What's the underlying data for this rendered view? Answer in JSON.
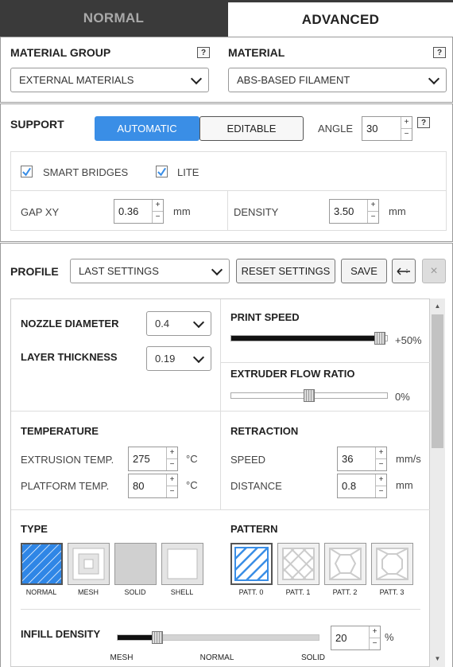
{
  "tabs": {
    "normal": "NORMAL",
    "advanced": "ADVANCED"
  },
  "material": {
    "group_label": "MATERIAL GROUP",
    "group_value": "EXTERNAL MATERIALS",
    "material_label": "MATERIAL",
    "material_value": "ABS-BASED FILAMENT",
    "help": "?"
  },
  "support": {
    "label": "SUPPORT",
    "automatic": "AUTOMATIC",
    "editable": "EDITABLE",
    "angle_label": "ANGLE",
    "angle_value": "30",
    "smart_bridges": "SMART BRIDGES",
    "smart_bridges_checked": true,
    "lite": "LITE",
    "lite_checked": true,
    "gap_xy_label": "GAP XY",
    "gap_xy_value": "0.36",
    "gap_unit": "mm",
    "density_label": "DENSITY",
    "density_value": "3.50",
    "density_unit": "mm",
    "accent": "#3a8ee6"
  },
  "profile": {
    "label": "PROFILE",
    "value": "LAST SETTINGS",
    "reset": "RESET SETTINGS",
    "save": "SAVE",
    "close": "×"
  },
  "settings": {
    "nozzle_label": "NOZZLE DIAMETER",
    "nozzle_value": "0.4",
    "layer_label": "LAYER THICKNESS",
    "layer_value": "0.19",
    "print_speed_label": "PRINT SPEED",
    "print_speed_value": "+50%",
    "print_speed_fraction": 0.99,
    "flow_label": "EXTRUDER FLOW RATIO",
    "flow_value": "0%",
    "flow_fraction": 0.5,
    "temperature_label": "TEMPERATURE",
    "extrusion_label": "EXTRUSION TEMP.",
    "extrusion_value": "275",
    "platform_label": "PLATFORM TEMP.",
    "platform_value": "80",
    "temp_unit": "°C",
    "retraction_label": "RETRACTION",
    "speed_label": "SPEED",
    "speed_value": "36",
    "speed_unit": "mm/s",
    "distance_label": "DISTANCE",
    "distance_value": "0.8",
    "distance_unit": "mm"
  },
  "infill": {
    "type_label": "TYPE",
    "types": [
      "NORMAL",
      "MESH",
      "SOLID",
      "SHELL"
    ],
    "pattern_label": "PATTERN",
    "patterns": [
      "PATT. 0",
      "PATT. 1",
      "PATT. 2",
      "PATT. 3"
    ],
    "density_label": "INFILL DENSITY",
    "density_value": "20",
    "density_unit": "%",
    "density_fraction": 0.2,
    "scale_labels": [
      "MESH",
      "NORMAL",
      "SOLID"
    ]
  }
}
